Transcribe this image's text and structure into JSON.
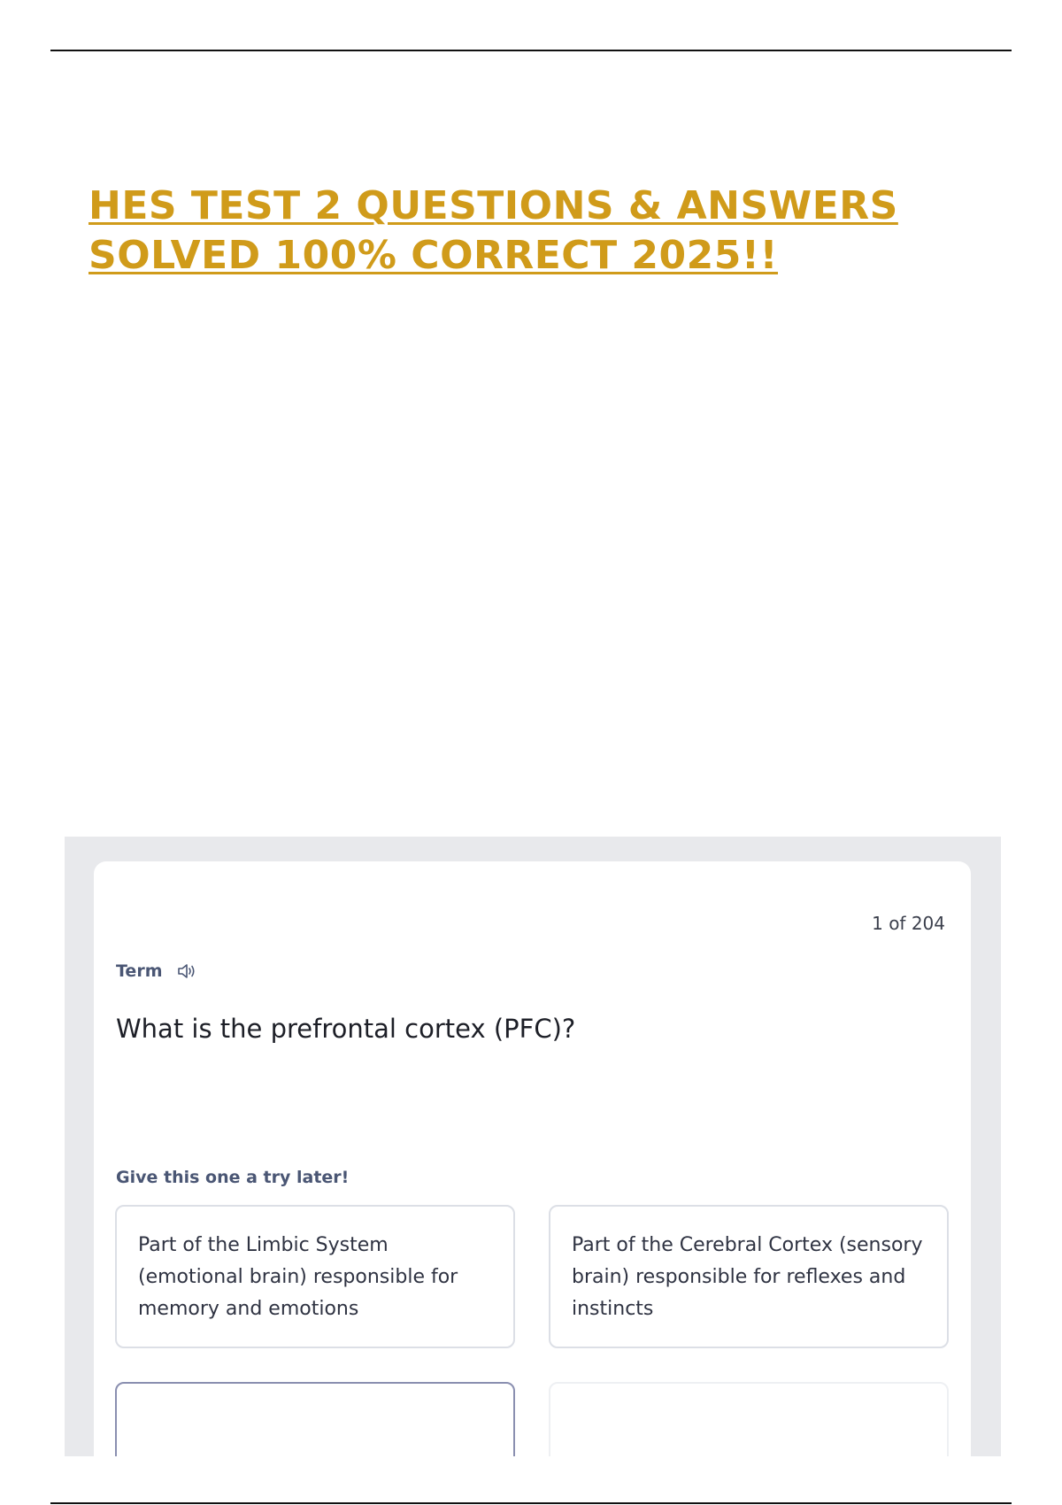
{
  "document": {
    "title_line1": "HES TEST 2 QUESTIONS & ANSWERS",
    "title_line2": "SOLVED 100% CORRECT 2025!!",
    "title_color": "#d09b1a"
  },
  "flashcard": {
    "counter": "1 of 204",
    "term_label": "Term",
    "audio_icon": "speaker-icon",
    "question": "What is the prefrontal cortex (PFC)?",
    "hint": "Give this one a try later!",
    "options": [
      {
        "text": "Part of the Limbic System (emotional brain) responsible for memory and emotions"
      },
      {
        "text": "Part of the Cerebral Cortex (sensory brain) responsible for reflexes and instincts"
      },
      {
        "text": ""
      },
      {
        "text": ""
      }
    ],
    "label_color": "#4a5674"
  }
}
